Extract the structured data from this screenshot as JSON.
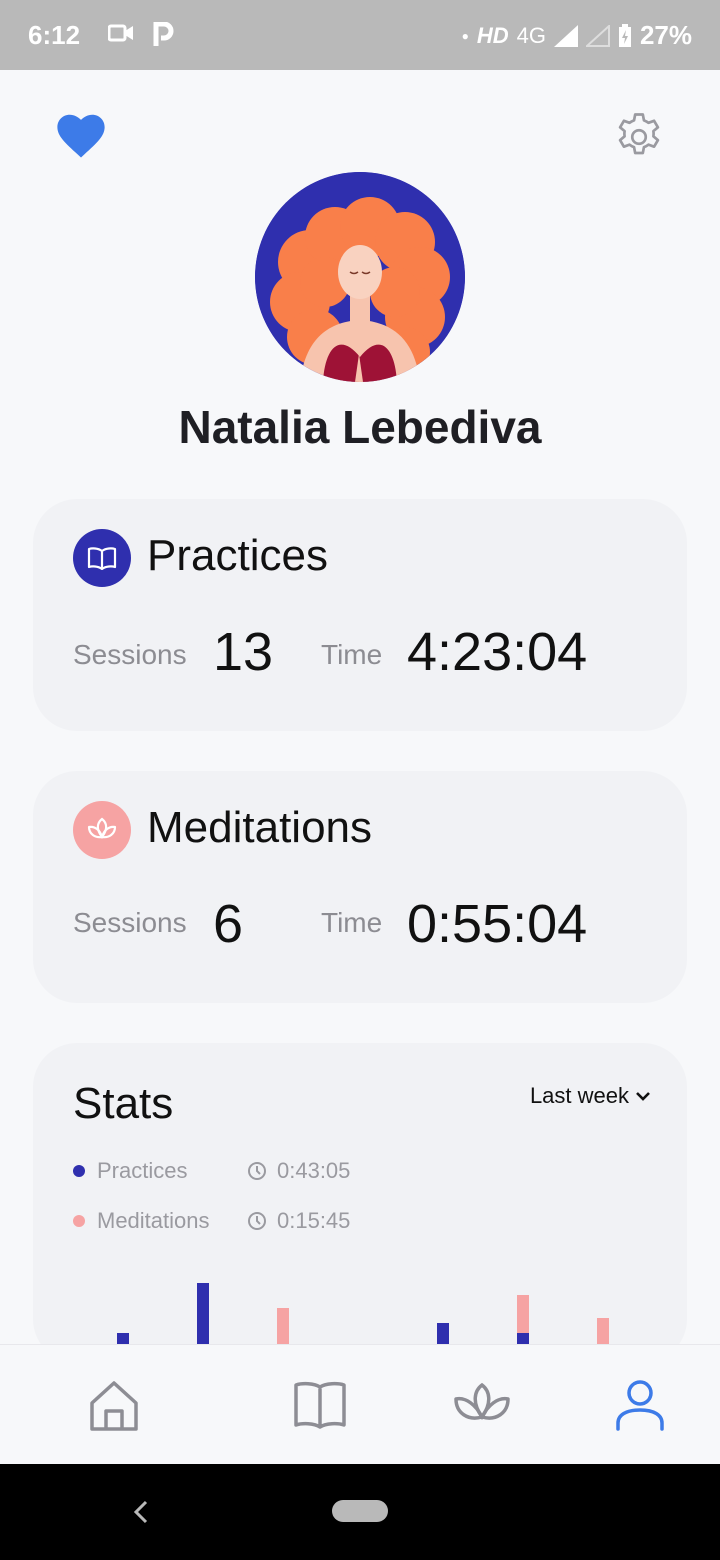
{
  "status_bar": {
    "time": "6:12",
    "network": "HD",
    "signal": "4G",
    "battery": "27%"
  },
  "profile": {
    "name": "Natalia Lebediva"
  },
  "practices": {
    "title": "Practices",
    "sessions_label": "Sessions",
    "sessions_value": "13",
    "time_label": "Time",
    "time_value": "4:23:04",
    "icon": "book-icon",
    "color": "#2f2fae"
  },
  "meditations": {
    "title": "Meditations",
    "sessions_label": "Sessions",
    "sessions_value": "6",
    "time_label": "Time",
    "time_value": "0:55:04",
    "icon": "lotus-icon",
    "color": "#f6a3a3"
  },
  "stats": {
    "title": "Stats",
    "period": "Last week",
    "legend": [
      {
        "name": "Practices",
        "time": "0:43:05",
        "color": "#2f2fae"
      },
      {
        "name": "Meditations",
        "time": "0:15:45",
        "color": "#f6a3a3"
      }
    ]
  },
  "chart_data": {
    "type": "bar",
    "categories": [
      "",
      "",
      "",
      "",
      "",
      "",
      ""
    ],
    "series": [
      {
        "name": "Practices",
        "values": [
          15,
          65,
          0,
          0,
          25,
          15,
          0
        ]
      },
      {
        "name": "Meditations",
        "values": [
          0,
          0,
          40,
          2,
          0,
          38,
          30
        ]
      }
    ],
    "stacked": true,
    "colors": [
      "#2f2fae",
      "#f6a3a3"
    ]
  },
  "bottom_nav": {
    "items": [
      "home-icon",
      "book-icon",
      "lotus-icon",
      "profile-icon"
    ],
    "active": 3,
    "active_color": "#3d7be8",
    "inactive_color": "#8d8d94"
  }
}
